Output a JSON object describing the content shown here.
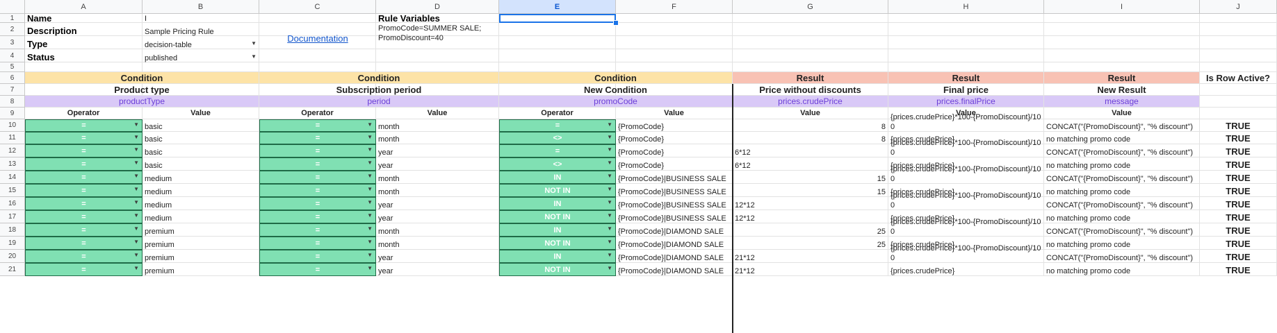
{
  "columns": [
    "A",
    "B",
    "C",
    "D",
    "E",
    "F",
    "G",
    "H",
    "I",
    "J"
  ],
  "rows": [
    "1",
    "2",
    "3",
    "4",
    "5",
    "6",
    "7",
    "8",
    "9",
    "10",
    "11",
    "12",
    "13",
    "14",
    "15",
    "16",
    "17",
    "18",
    "19",
    "20",
    "21"
  ],
  "meta": {
    "name_label": "Name",
    "name_value": "I",
    "description_label": "Description",
    "description_value": "Sample Pricing Rule",
    "type_label": "Type",
    "type_value": "decision-table",
    "status_label": "Status",
    "status_value": "published",
    "documentation_link": "Documentation",
    "rule_variables_label": "Rule Variables",
    "rule_variables_value": "PromoCode=SUMMER SALE; PromoDiscount=40"
  },
  "header": {
    "groups": [
      "Condition",
      "Condition",
      "Condition",
      "Result",
      "Result",
      "Result",
      "Is Row Active?"
    ],
    "titles": [
      "Product type",
      "Subscription period",
      "New Condition",
      "Price without discounts",
      "Final price",
      "New Result"
    ],
    "fields": [
      "productType",
      "period",
      "promoCode",
      "prices.crudePrice",
      "prices.finalPrice",
      "message"
    ],
    "subheaders": [
      "Operator",
      "Value",
      "Operator",
      "Value",
      "Operator",
      "Value",
      "Value",
      "Value",
      "Value"
    ]
  },
  "table_rows": [
    {
      "op1": "=",
      "val1": "basic",
      "op2": "=",
      "val2": "month",
      "op3": "=",
      "val3": "{PromoCode}",
      "crude": "8",
      "final": "{prices.crudePrice}*100-{PromoDiscount}/100",
      "msg": "CONCAT(\"{PromoDiscount}\", \"% discount\")",
      "active": "TRUE"
    },
    {
      "op1": "=",
      "val1": "basic",
      "op2": "=",
      "val2": "month",
      "op3": "<>",
      "val3": "{PromoCode}",
      "crude": "8",
      "final": "{prices.crudePrice}",
      "msg": "no matching promo code",
      "active": "TRUE"
    },
    {
      "op1": "=",
      "val1": "basic",
      "op2": "=",
      "val2": "year",
      "op3": "=",
      "val3": "{PromoCode}",
      "crude": "6*12",
      "final": "{prices.crudePrice}*100-{PromoDiscount}/100",
      "msg": "CONCAT(\"{PromoDiscount}\", \"% discount\")",
      "active": "TRUE"
    },
    {
      "op1": "=",
      "val1": "basic",
      "op2": "=",
      "val2": "year",
      "op3": "<>",
      "val3": "{PromoCode}",
      "crude": "6*12",
      "final": "{prices.crudePrice}",
      "msg": "no matching promo code",
      "active": "TRUE"
    },
    {
      "op1": "=",
      "val1": "medium",
      "op2": "=",
      "val2": "month",
      "op3": "IN",
      "val3": "{PromoCode}|BUSINESS SALE",
      "crude": "15",
      "final": "{prices.crudePrice}*100-{PromoDiscount}/100",
      "msg": "CONCAT(\"{PromoDiscount}\", \"% discount\")",
      "active": "TRUE"
    },
    {
      "op1": "=",
      "val1": "medium",
      "op2": "=",
      "val2": "month",
      "op3": "NOT IN",
      "val3": "{PromoCode}|BUSINESS SALE",
      "crude": "15",
      "final": "{prices.crudePrice}",
      "msg": "no matching promo code",
      "active": "TRUE"
    },
    {
      "op1": "=",
      "val1": "medium",
      "op2": "=",
      "val2": "year",
      "op3": "IN",
      "val3": "{PromoCode}|BUSINESS SALE",
      "crude": "12*12",
      "final": "{prices.crudePrice}*100-{PromoDiscount}/100",
      "msg": "CONCAT(\"{PromoDiscount}\", \"% discount\")",
      "active": "TRUE"
    },
    {
      "op1": "=",
      "val1": "medium",
      "op2": "=",
      "val2": "year",
      "op3": "NOT IN",
      "val3": "{PromoCode}|BUSINESS SALE",
      "crude": "12*12",
      "final": "{prices.crudePrice}",
      "msg": "no matching promo code",
      "active": "TRUE"
    },
    {
      "op1": "=",
      "val1": "premium",
      "op2": "=",
      "val2": "month",
      "op3": "IN",
      "val3": "{PromoCode}|DIAMOND SALE",
      "crude": "25",
      "final": "{prices.crudePrice}*100-{PromoDiscount}/100",
      "msg": "CONCAT(\"{PromoDiscount}\", \"% discount\")",
      "active": "TRUE"
    },
    {
      "op1": "=",
      "val1": "premium",
      "op2": "=",
      "val2": "month",
      "op3": "NOT IN",
      "val3": "{PromoCode}|DIAMOND SALE",
      "crude": "25",
      "final": "{prices.crudePrice}",
      "msg": "no matching promo code",
      "active": "TRUE"
    },
    {
      "op1": "=",
      "val1": "premium",
      "op2": "=",
      "val2": "year",
      "op3": "IN",
      "val3": "{PromoCode}|DIAMOND SALE",
      "crude": "21*12",
      "final": "{prices.crudePrice}*100-{PromoDiscount}/100",
      "msg": "CONCAT(\"{PromoDiscount}\", \"% discount\")",
      "active": "TRUE"
    },
    {
      "op1": "=",
      "val1": "premium",
      "op2": "=",
      "val2": "year",
      "op3": "NOT IN",
      "val3": "{PromoCode}|DIAMOND SALE",
      "crude": "21*12",
      "final": "{prices.crudePrice}",
      "msg": "no matching promo code",
      "active": "TRUE"
    }
  ],
  "selected_column": "E",
  "colors": {
    "condition_header": "#fde3a7",
    "result_header": "#f8c2b4",
    "field_row": "#d9c9f7",
    "operator_cell": "#80e0b3",
    "selection": "#1a73e8"
  },
  "icons": {
    "dropdown": "caret-down-icon"
  }
}
